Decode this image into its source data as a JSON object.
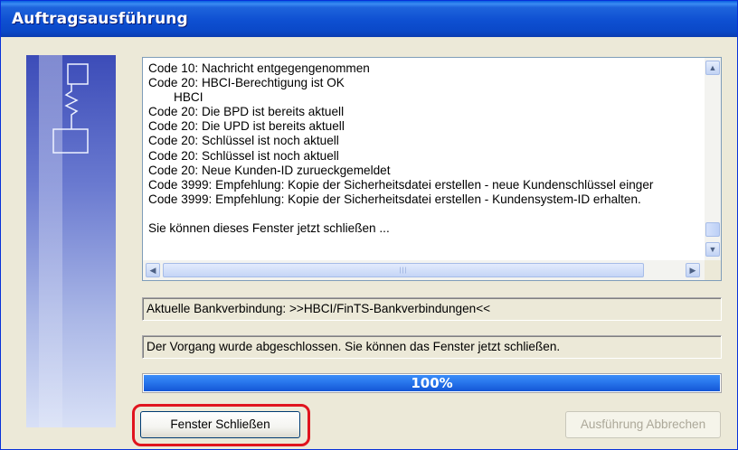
{
  "window": {
    "title": "Auftragsausführung"
  },
  "log": {
    "lines": [
      "Code 10: Nachricht entgegengenommen",
      "Code 20: HBCI-Berechtigung ist OK",
      "HBCI",
      "Code 20: Die BPD ist bereits aktuell",
      "Code 20: Die UPD ist bereits aktuell",
      "Code 20: Schlüssel ist noch aktuell",
      "Code 20: Schlüssel ist noch aktuell",
      "Code 20: Neue Kunden-ID zurueckgemeldet",
      "Code 3999: Empfehlung: Kopie der Sicherheitsdatei erstellen - neue Kundenschlüssel einger",
      "Code 3999: Empfehlung: Kopie der Sicherheitsdatei erstellen - Kundensystem-ID erhalten.",
      "",
      "Sie können dieses Fenster jetzt schließen ..."
    ]
  },
  "status": {
    "connection": "Aktuelle Bankverbindung: >>HBCI/FinTS-Bankverbindungen<<",
    "message": "Der Vorgang wurde abgeschlossen. Sie können das Fenster jetzt schließen."
  },
  "progress": {
    "label": "100%",
    "value": 1.0
  },
  "buttons": {
    "close": "Fenster Schließen",
    "abort": "Ausführung Abbrechen"
  },
  "colors": {
    "titlebar": "#0a48c7",
    "progress_fill": "#2a79ee",
    "highlight": "#e0141e"
  },
  "icons": {
    "scroll_up": "scroll-up-arrow-icon",
    "scroll_down": "scroll-down-arrow-icon",
    "scroll_left": "scroll-left-arrow-icon",
    "scroll_right": "scroll-right-arrow-icon"
  }
}
